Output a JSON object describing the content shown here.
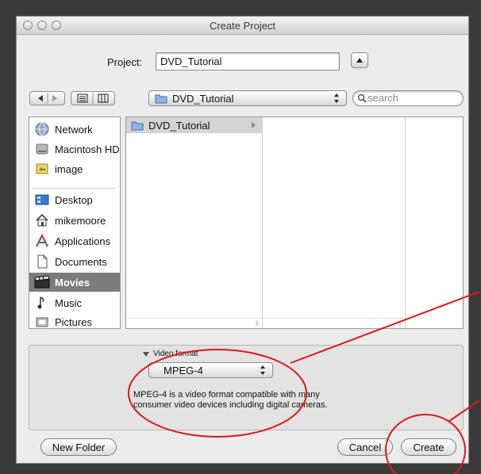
{
  "window": {
    "title": "Create Project"
  },
  "project": {
    "label": "Project:",
    "value": "DVD_Tutorial"
  },
  "location": {
    "current": "DVD_Tutorial"
  },
  "search": {
    "placeholder": "search"
  },
  "sidebar": {
    "items": [
      {
        "label": "Network",
        "icon": "network-icon"
      },
      {
        "label": "Macintosh HD",
        "icon": "hard-drive-icon"
      },
      {
        "label": "image",
        "icon": "disk-image-icon"
      },
      {
        "label": "Desktop",
        "icon": "desktop-icon"
      },
      {
        "label": "mikemoore",
        "icon": "home-icon"
      },
      {
        "label": "Applications",
        "icon": "applications-icon"
      },
      {
        "label": "Documents",
        "icon": "documents-icon"
      },
      {
        "label": "Movies",
        "icon": "movies-icon"
      },
      {
        "label": "Music",
        "icon": "music-icon"
      },
      {
        "label": "Pictures",
        "icon": "pictures-icon"
      }
    ],
    "selected": "Movies"
  },
  "browser": {
    "column1": [
      "DVD_Tutorial"
    ]
  },
  "video": {
    "label": "Video format",
    "format": "MPEG-4",
    "description": "MPEG-4 is a video format compatible with many consumer video devices including digital cameras."
  },
  "buttons": {
    "new_folder": "New Folder",
    "cancel": "Cancel",
    "create": "Create"
  },
  "colors": {
    "annotation": "#e01818",
    "selection": "#7c7c7c"
  }
}
